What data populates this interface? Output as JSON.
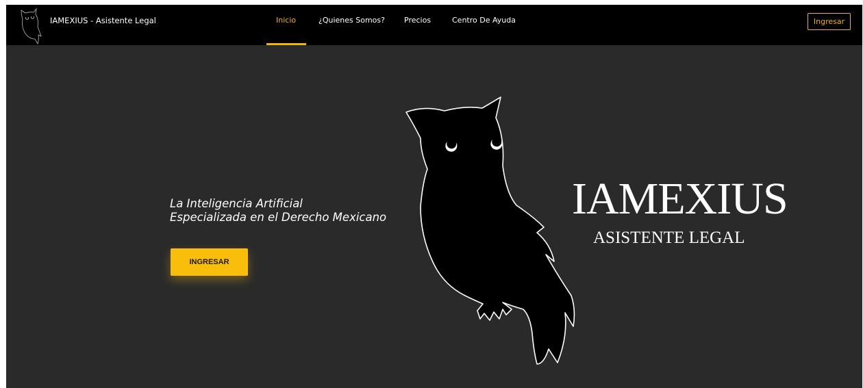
{
  "navbar": {
    "brand": "IAMEXIUS - Asistente Legal",
    "items": [
      {
        "label": "Inicio",
        "active": true
      },
      {
        "label": "¿Quienes Somos?",
        "active": false
      },
      {
        "label": "Precios",
        "active": false
      },
      {
        "label": "Centro De Ayuda",
        "active": false
      }
    ],
    "login_label": "Ingresar",
    "logo_icon": "owl-icon"
  },
  "hero": {
    "tagline_line1": "La Inteligencia Artificial",
    "tagline_line2": "Especializada en el Derecho Mexicano",
    "cta_label": "INGRESAR",
    "title": "IAMEXIUS",
    "subtitle": "ASISTENTE LEGAL",
    "illustration_icon": "owl-illustration"
  },
  "colors": {
    "accent": "#f2b500",
    "button": "#f9bd0b",
    "background": "#2a2a2a",
    "navbar": "#000000"
  }
}
